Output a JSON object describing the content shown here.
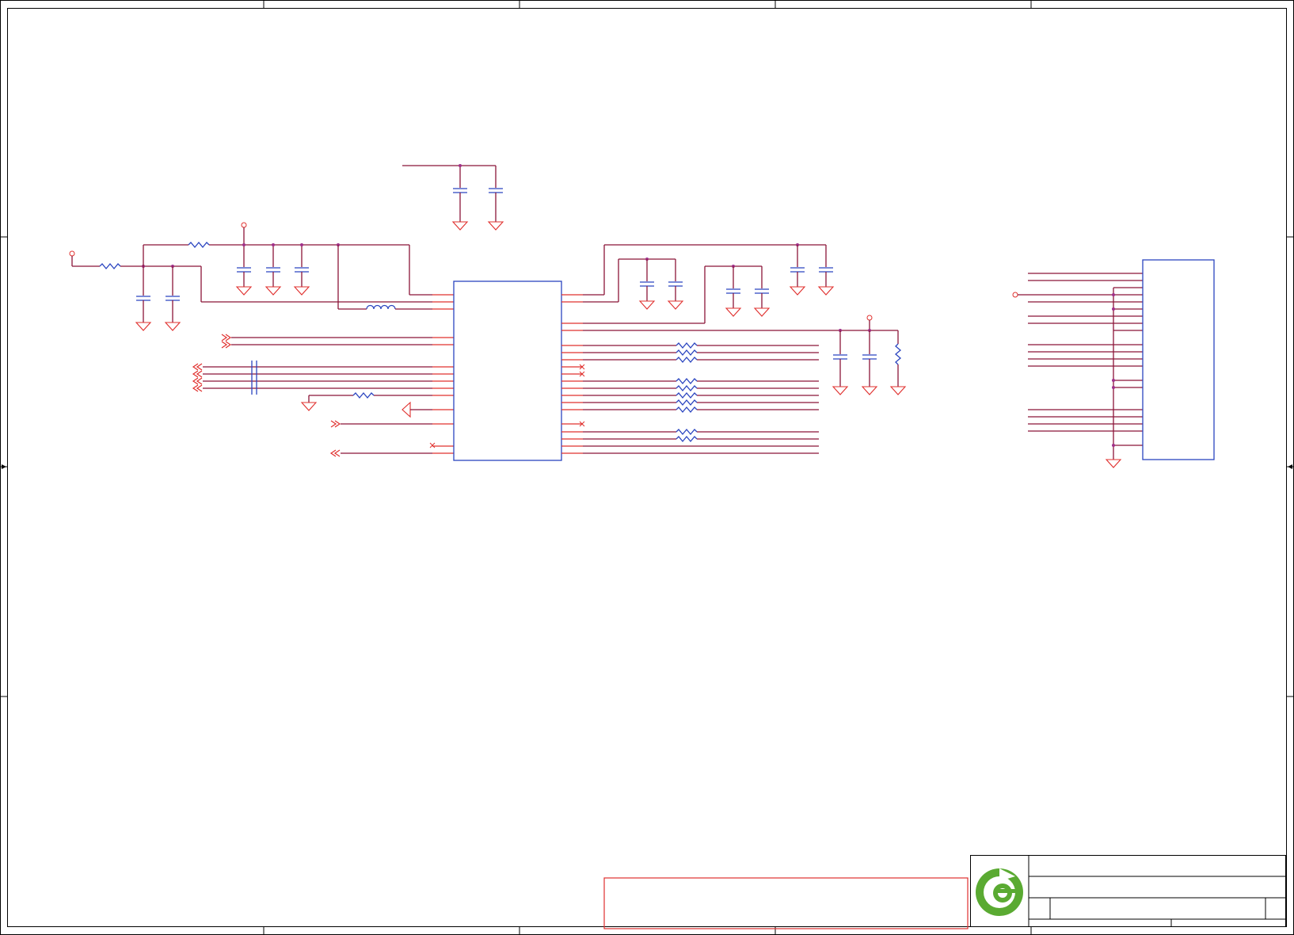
{
  "document": {
    "type": "electronic-schematic",
    "colors": {
      "frame": "#000000",
      "wire": "#8b1538",
      "pin": "#e0302e",
      "component": "#2b45c0",
      "junction": "#a0308a",
      "logo_green": "#5aaa32"
    }
  },
  "components": {
    "main_ic": "integrated-circuit",
    "connector": "connector-header",
    "logo": "company-logo-icon"
  },
  "title_block": {
    "logo_icon": "company-logo-icon"
  }
}
